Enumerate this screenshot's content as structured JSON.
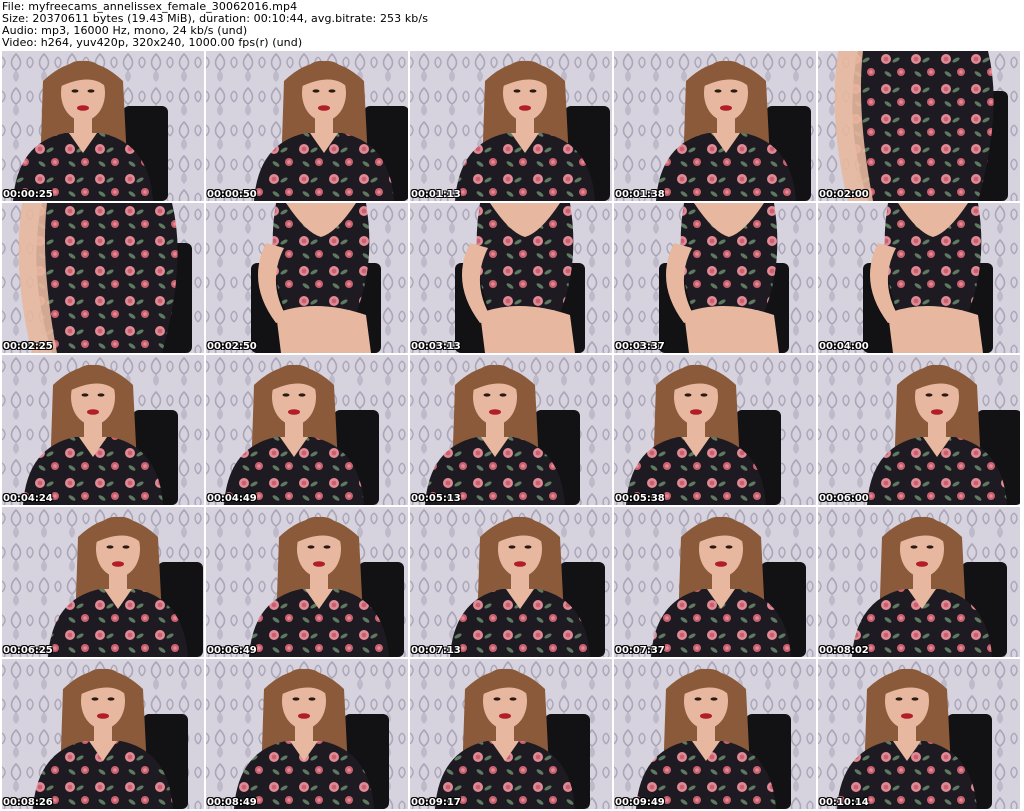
{
  "header": {
    "file_line": "File: myfreecams_annelissex_female_30062016.mp4",
    "size_line": "Size: 20370611 bytes (19.43 MiB), duration: 00:10:44, avg.bitrate: 253 kb/s",
    "audio_line": "Audio: mp3, 16000 Hz, mono, 24 kb/s (und)",
    "video_line": "Video: h264, yuv420p, 320x240, 1000.00 fps(r) (und)"
  },
  "colors": {
    "wallpaper": "#d6d3de",
    "wallpaper_pattern": "#aaa5b8",
    "dress": "#1d1a22",
    "flower_pink": "#e08a96",
    "flower_rose": "#c9606e",
    "leaf": "#5e7a60",
    "skin": "#e7b89f",
    "hair": "#8a5a3a",
    "lips": "#b01e2a",
    "chair": "#121114"
  },
  "thumbnails": [
    {
      "timestamp": "00:00:25",
      "pose": "face"
    },
    {
      "timestamp": "00:00:50",
      "pose": "face"
    },
    {
      "timestamp": "00:01:13",
      "pose": "face"
    },
    {
      "timestamp": "00:01:38",
      "pose": "face"
    },
    {
      "timestamp": "00:02:00",
      "pose": "body"
    },
    {
      "timestamp": "00:02:25",
      "pose": "body"
    },
    {
      "timestamp": "00:02:50",
      "pose": "seated"
    },
    {
      "timestamp": "00:03:13",
      "pose": "seated"
    },
    {
      "timestamp": "00:03:37",
      "pose": "seated"
    },
    {
      "timestamp": "00:04:00",
      "pose": "seated"
    },
    {
      "timestamp": "00:04:24",
      "pose": "face"
    },
    {
      "timestamp": "00:04:49",
      "pose": "face"
    },
    {
      "timestamp": "00:05:13",
      "pose": "face"
    },
    {
      "timestamp": "00:05:38",
      "pose": "face"
    },
    {
      "timestamp": "00:06:00",
      "pose": "face"
    },
    {
      "timestamp": "00:06:25",
      "pose": "face"
    },
    {
      "timestamp": "00:06:49",
      "pose": "face"
    },
    {
      "timestamp": "00:07:13",
      "pose": "face"
    },
    {
      "timestamp": "00:07:37",
      "pose": "face"
    },
    {
      "timestamp": "00:08:02",
      "pose": "face"
    },
    {
      "timestamp": "00:08:26",
      "pose": "face"
    },
    {
      "timestamp": "00:08:49",
      "pose": "face"
    },
    {
      "timestamp": "00:09:17",
      "pose": "face"
    },
    {
      "timestamp": "00:09:49",
      "pose": "face"
    },
    {
      "timestamp": "00:10:14",
      "pose": "face"
    }
  ]
}
